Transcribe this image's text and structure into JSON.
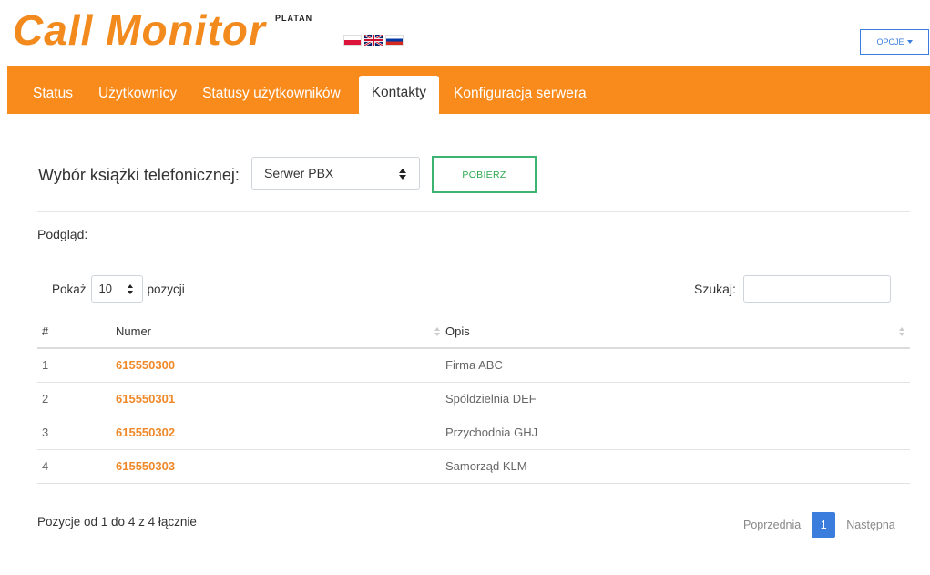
{
  "header": {
    "logo_text": "Call Monitor",
    "logo_brand": "PLATAN",
    "options_label": "OPCJE"
  },
  "languages": [
    "pl",
    "en",
    "ru"
  ],
  "colors": {
    "brand_orange": "#f98b1d",
    "primary_blue": "#3b7ddd",
    "fetch_green": "#3cb371",
    "link_orange": "#f0892a"
  },
  "nav": {
    "tabs": [
      {
        "label": "Status"
      },
      {
        "label": "Użytkownicy"
      },
      {
        "label": "Statusy użytkowników"
      },
      {
        "label": "Kontakty",
        "active": true
      },
      {
        "label": "Konfiguracja serwera"
      }
    ]
  },
  "phonebook": {
    "label": "Wybór książki telefonicznej:",
    "selected": "Serwer PBX",
    "fetch_label": "POBIERZ"
  },
  "preview": {
    "label": "Podgląd:",
    "show_prefix": "Pokaż",
    "show_value": "10",
    "show_suffix": "pozycji",
    "search_label": "Szukaj:",
    "search_value": ""
  },
  "table": {
    "columns": [
      "#",
      "Numer",
      "Opis"
    ],
    "rows": [
      {
        "index": "1",
        "number": "615550300",
        "desc": "Firma ABC"
      },
      {
        "index": "2",
        "number": "615550301",
        "desc": "Spóldzielnia DEF"
      },
      {
        "index": "3",
        "number": "615550302",
        "desc": "Przychodnia GHJ"
      },
      {
        "index": "4",
        "number": "615550303",
        "desc": "Samorząd KLM"
      }
    ]
  },
  "footer": {
    "info": "Pozycje od 1 do 4 z 4 łącznie",
    "prev": "Poprzednia",
    "current": "1",
    "next": "Następna"
  }
}
